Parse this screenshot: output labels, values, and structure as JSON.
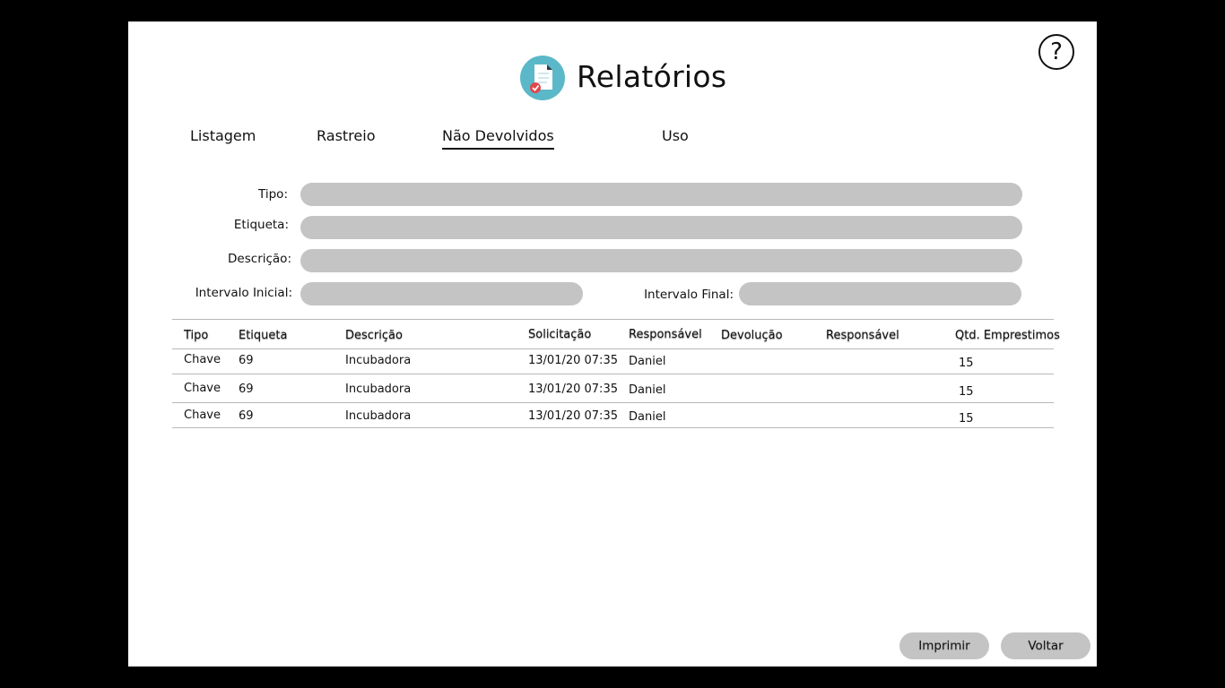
{
  "header": {
    "title": "Relatórios",
    "help_icon": "?"
  },
  "tabs": [
    {
      "label": "Listagem"
    },
    {
      "label": "Rastreio"
    },
    {
      "label": "Não Devolvidos",
      "active": true
    },
    {
      "label": "Uso"
    }
  ],
  "form": {
    "tipo_label": "Tipo:",
    "etiqueta_label": "Etiqueta:",
    "descricao_label": "Descrição:",
    "intervalo_inicial_label": "Intervalo Inicial:",
    "intervalo_final_label": "Intervalo Final:",
    "tipo_value": "",
    "etiqueta_value": "",
    "descricao_value": "",
    "intervalo_inicial_value": "",
    "intervalo_final_value": ""
  },
  "table": {
    "columns": [
      "Tipo",
      "Etiqueta",
      "Descrição",
      "Solicitação",
      "Responsável",
      "Devolução",
      "Responsável",
      "Qtd. Emprestimos"
    ],
    "rows": [
      [
        "Chave",
        "69",
        "Incubadora",
        "13/01/20 07:35",
        "Daniel",
        "",
        "",
        "15"
      ],
      [
        "Chave",
        "69",
        "Incubadora",
        "13/01/20 07:35",
        "Daniel",
        "",
        "",
        "15"
      ],
      [
        "Chave",
        "69",
        "Incubadora",
        "13/01/20 07:35",
        "Daniel",
        "",
        "",
        "15"
      ]
    ]
  },
  "actions": {
    "print_label": "Imprimir",
    "back_label": "Voltar"
  },
  "colors": {
    "field_fill": "#c4c4c4",
    "logo_circle": "#5bb8c8",
    "check_badge": "#e0474c"
  }
}
